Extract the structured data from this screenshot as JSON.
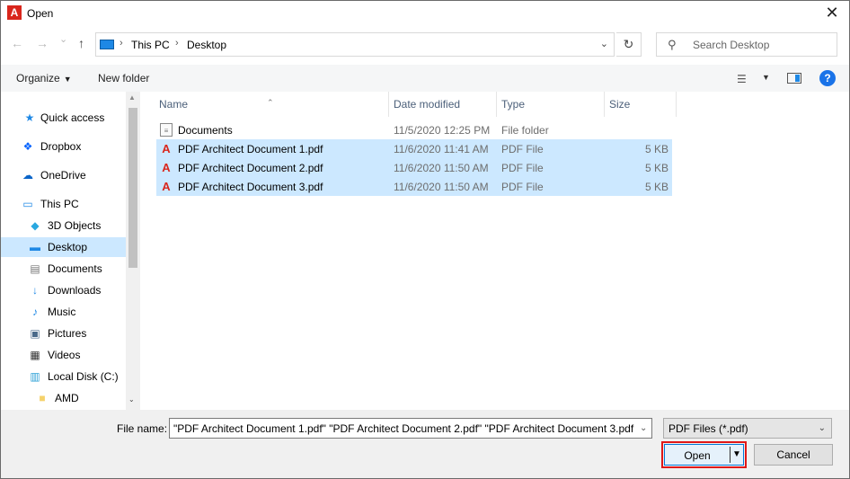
{
  "window": {
    "title": "Open",
    "app_icon_letter": "A",
    "close_glyph": "✕"
  },
  "address": {
    "back_glyph": "←",
    "forward_glyph": "→",
    "recent_glyph": "⌄",
    "up_glyph": "↑",
    "crumbs": [
      "This PC",
      "Desktop"
    ],
    "sep_glyph": "›",
    "dropdown_glyph": "⌄",
    "refresh_glyph": "↻"
  },
  "search": {
    "placeholder": "Search Desktop",
    "icon_glyph": "⚲"
  },
  "toolbar": {
    "organize_label": "Organize",
    "organize_caret": "▼",
    "new_folder_label": "New folder",
    "view_glyph": "☰",
    "view_caret": "▼",
    "help_glyph": "?"
  },
  "nav": {
    "items": [
      {
        "label": "Quick access",
        "icon": "★",
        "icon_color": "#1e88e5"
      },
      {
        "label": "Dropbox",
        "icon": "❖",
        "icon_color": "#0061fe"
      },
      {
        "label": "OneDrive",
        "icon": "☁",
        "icon_color": "#0a64c8"
      },
      {
        "label": "This PC",
        "icon": "▭",
        "icon_color": "#1e88e5"
      },
      {
        "label": "3D Objects",
        "icon": "◆",
        "icon_color": "#29a8e0"
      },
      {
        "label": "Desktop",
        "icon": "▬",
        "icon_color": "#1e88e5"
      },
      {
        "label": "Documents",
        "icon": "▤",
        "icon_color": "#777777"
      },
      {
        "label": "Downloads",
        "icon": "↓",
        "icon_color": "#1e88e5"
      },
      {
        "label": "Music",
        "icon": "♪",
        "icon_color": "#1e88e5"
      },
      {
        "label": "Pictures",
        "icon": "▣",
        "icon_color": "#4a6a8a"
      },
      {
        "label": "Videos",
        "icon": "▦",
        "icon_color": "#333333"
      },
      {
        "label": "Local Disk (C:)",
        "icon": "▥",
        "icon_color": "#2a9fd6"
      },
      {
        "label": "AMD",
        "icon": "■",
        "icon_color": "#f5d26b"
      }
    ],
    "scroll_up_glyph": "▲",
    "scroll_down_glyph": "⌄"
  },
  "columns": {
    "name": "Name",
    "date": "Date modified",
    "type": "Type",
    "size": "Size",
    "sort_glyph": "⌃"
  },
  "files": [
    {
      "name": "Documents",
      "date": "11/5/2020 12:25 PM",
      "type": "File folder",
      "size": "",
      "icon": "≡"
    },
    {
      "name": "PDF Architect Document 1.pdf",
      "date": "11/6/2020 11:41 AM",
      "type": "PDF File",
      "size": "5 KB",
      "icon": "A"
    },
    {
      "name": "PDF Architect Document 2.pdf",
      "date": "11/6/2020 11:50 AM",
      "type": "PDF File",
      "size": "5 KB",
      "icon": "A"
    },
    {
      "name": "PDF Architect Document 3.pdf",
      "date": "11/6/2020 11:50 AM",
      "type": "PDF File",
      "size": "5 KB",
      "icon": "A"
    }
  ],
  "bottom": {
    "file_name_label": "File name:",
    "file_name_value": "\"PDF Architect Document 1.pdf\" \"PDF Architect Document 2.pdf\" \"PDF Architect Document 3.pdf",
    "file_name_caret": "⌄",
    "file_type_value": "PDF Files (*.pdf)",
    "file_type_caret": "⌄",
    "open_label": "Open",
    "open_caret": "▼",
    "cancel_label": "Cancel"
  },
  "colors": {
    "selection": "#cce8ff",
    "accent": "#0078d7",
    "highlight_outline": "#e01818",
    "pdf_red": "#d9261c"
  }
}
